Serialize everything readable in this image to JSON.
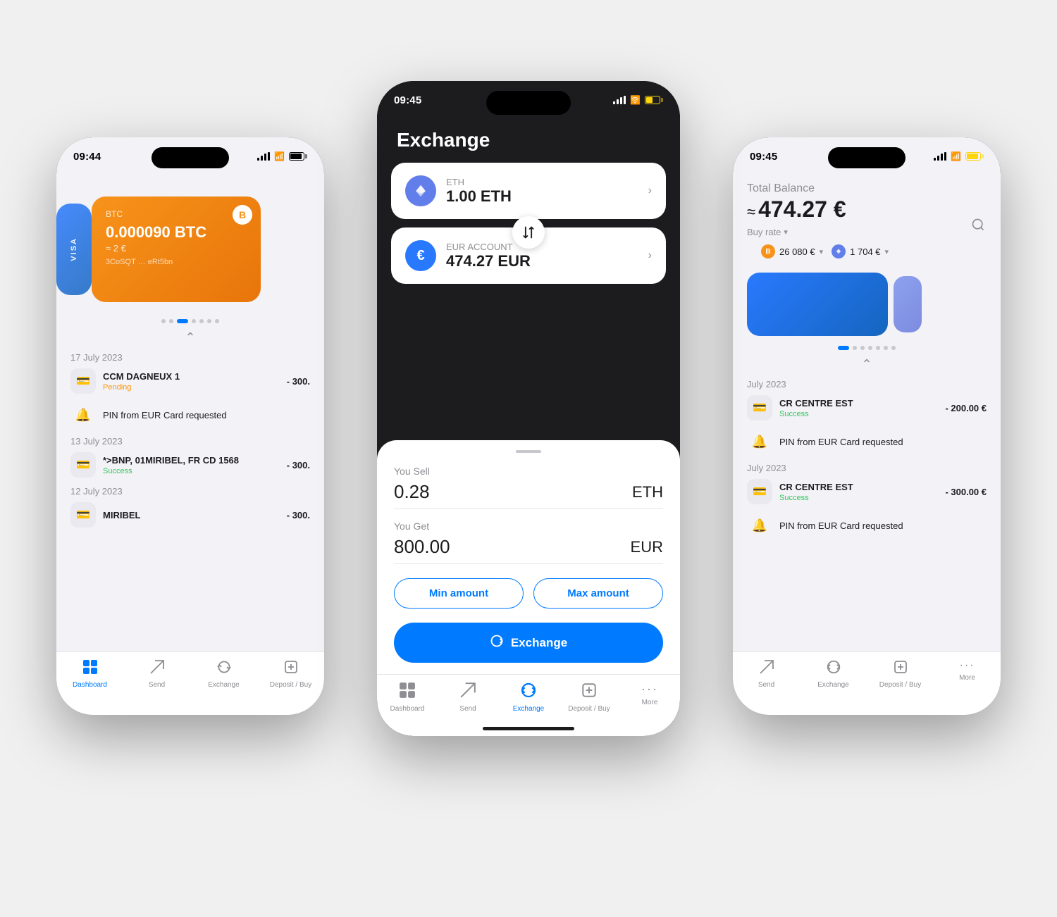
{
  "left_phone": {
    "status_time": "09:44",
    "btc_card": {
      "label": "BTC",
      "amount": "0.000090 BTC",
      "eur": "≈ 2 €",
      "address": "3CoSQT … eRt5bn",
      "badge": "B"
    },
    "transactions": [
      {
        "date": "17 July 2023",
        "items": [
          {
            "name": "CCM DAGNEUX 1",
            "amount": "- 300.",
            "status": "Pending",
            "status_type": "pending"
          },
          {
            "type": "notif",
            "text": "PIN from EUR Card requested"
          }
        ]
      },
      {
        "date": "13 July 2023",
        "items": [
          {
            "name": "*>BNP, 01MIRIBEL, FR CD 1568",
            "amount": "- 300.",
            "status": "Success",
            "status_type": "success"
          }
        ]
      },
      {
        "date": "12 July 2023",
        "items": [
          {
            "name": "MIRIBEL",
            "amount": "- 300.",
            "status": "",
            "status_type": ""
          }
        ]
      }
    ],
    "nav": [
      {
        "label": "Dashboard",
        "icon": "🏠",
        "active": true
      },
      {
        "label": "Send",
        "icon": "✉",
        "active": false
      },
      {
        "label": "Exchange",
        "icon": "🔄",
        "active": false
      },
      {
        "label": "Deposit / Buy",
        "icon": "➕",
        "active": false
      }
    ]
  },
  "center_phone": {
    "status_time": "09:45",
    "title": "Exchange",
    "sell_coin": {
      "label": "ETH",
      "amount": "1.00 ETH"
    },
    "buy_coin": {
      "label": "EUR ACCOUNT",
      "amount": "474.27 EUR"
    },
    "you_sell_label": "You Sell",
    "you_sell_value": "0.28",
    "you_sell_currency": "ETH",
    "you_get_label": "You Get",
    "you_get_value": "800.00",
    "you_get_currency": "EUR",
    "min_amount_label": "Min amount",
    "max_amount_label": "Max amount",
    "exchange_btn_label": "Exchange",
    "nav": [
      {
        "label": "Dashboard",
        "icon": "🏠",
        "active": false
      },
      {
        "label": "Send",
        "icon": "✉",
        "active": false
      },
      {
        "label": "Exchange",
        "icon": "🔄",
        "active": true
      },
      {
        "label": "Deposit / Buy",
        "icon": "➕",
        "active": false
      },
      {
        "label": "More",
        "icon": "···",
        "active": false
      }
    ]
  },
  "right_phone": {
    "status_time": "09:45",
    "total_balance_label": "Total Balance",
    "total_balance": "474.27 €",
    "buy_rate_label": "Buy rate",
    "btc_price": "26 080 €",
    "eth_price": "1 704 €",
    "transactions": [
      {
        "date": "July 2023",
        "items": [
          {
            "name": "CR CENTRE EST",
            "amount": "- 200.00 €",
            "status": "Success",
            "status_type": "success"
          },
          {
            "type": "notif",
            "text": "PIN from EUR Card requested"
          }
        ]
      },
      {
        "date": "July 2023",
        "items": [
          {
            "name": "CR CENTRE EST",
            "amount": "- 300.00 €",
            "status": "Success",
            "status_type": "success"
          },
          {
            "type": "notif",
            "text": "PIN from EUR Card requested"
          }
        ]
      }
    ],
    "nav": [
      {
        "label": "Send",
        "icon": "✉",
        "active": false
      },
      {
        "label": "Exchange",
        "icon": "🔄",
        "active": false
      },
      {
        "label": "Deposit / Buy",
        "icon": "➕",
        "active": false
      },
      {
        "label": "More",
        "icon": "···",
        "active": false
      }
    ]
  }
}
